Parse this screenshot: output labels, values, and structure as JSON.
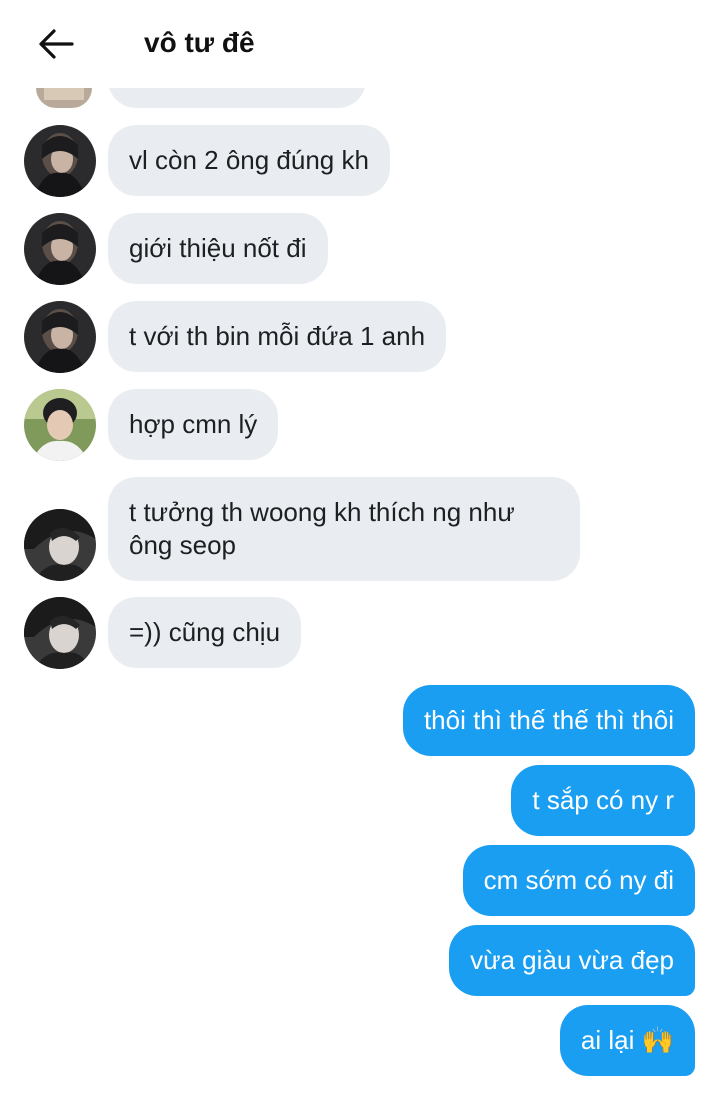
{
  "header": {
    "title": "vô tư đê",
    "back_icon": "arrow-left-icon"
  },
  "incoming": [
    {
      "text": "vl còn 2 ông đúng kh",
      "avatar": "avatar-dark-hood"
    },
    {
      "text": "giới thiệu nốt đi",
      "avatar": "avatar-dark-hood"
    },
    {
      "text": "t với th bin mỗi đứa 1 anh",
      "avatar": "avatar-dark-hood"
    },
    {
      "text": "hợp cmn lý",
      "avatar": "avatar-boy-outdoor"
    },
    {
      "text": "t tưởng th woong kh thích ng như ông seop",
      "avatar": "avatar-bw-portrait"
    },
    {
      "text": "=)) cũng chịu",
      "avatar": "avatar-bw-portrait"
    }
  ],
  "outgoing": [
    {
      "text": "thôi thì thế thế thì thôi"
    },
    {
      "text": "t sắp có ny r"
    },
    {
      "text": "cm sớm có ny đi"
    },
    {
      "text": "vừa giàu vừa đẹp"
    },
    {
      "text": "ai lại 🙌"
    }
  ],
  "colors": {
    "incoming_bubble": "#e9edf1",
    "outgoing_bubble": "#1a9ef2",
    "outgoing_text": "#ffffff"
  }
}
